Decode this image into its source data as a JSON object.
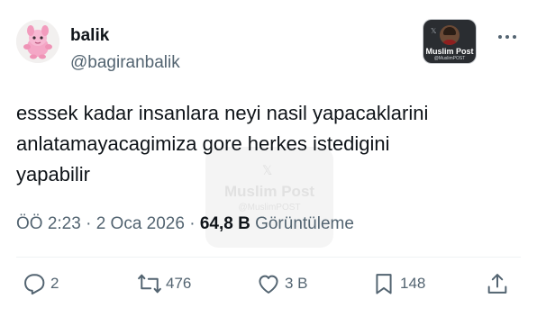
{
  "author": {
    "display_name": "balik",
    "handle": "@bagiranbalik",
    "avatar_icon": "pink-creature-avatar"
  },
  "badge": {
    "title": "Muslim Post",
    "handle": "@MuslimPOST"
  },
  "watermark": {
    "title": "Muslim Post",
    "handle": "@MuslimPOST"
  },
  "tweet": {
    "text": "esssek kadar insanlara neyi nasil yapacaklarini\nanlatamayacagimiza gore herkes istedigini\nyapabilir"
  },
  "meta": {
    "time_date": "ÖÖ 2:23 · 2 Oca 2026 · ",
    "views_count": "64,8 B",
    "views_label": " Görüntüleme"
  },
  "actions": {
    "replies": "2",
    "reposts": "476",
    "likes": "3 B",
    "bookmarks": "148"
  },
  "colors": {
    "text_primary": "#0f1419",
    "text_secondary": "#536471",
    "divider": "#eff3f4"
  }
}
